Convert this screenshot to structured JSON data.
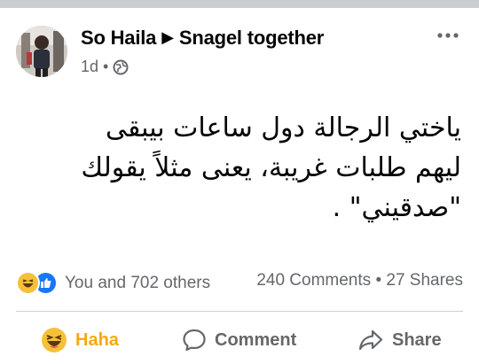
{
  "post": {
    "author": "So Haila",
    "group": "Snagel together",
    "time": "1d",
    "separator": "•",
    "text_lines": [
      "ياختي الرجالة دول ساعات بيبقى",
      "ليهم طلبات غريبة، يعنى مثلاً يقولك",
      "\"صدقيني\" ."
    ]
  },
  "stats": {
    "reactions_text": "You and 702 others",
    "comments_text": "240 Comments",
    "dot": "•",
    "shares_text": "27 Shares"
  },
  "actions": {
    "haha_label": "Haha",
    "comment_label": "Comment",
    "share_label": "Share"
  },
  "colors": {
    "accent_haha": "#f7a80d",
    "like_blue": "#1877f2",
    "secondary_text": "#65676b"
  },
  "icons": {
    "author_arrow": "right-triangle-icon",
    "privacy": "globe-icon",
    "more": "more-options-icon",
    "haha": "haha-emoji-icon",
    "like": "like-thumb-icon",
    "comment": "comment-bubble-icon",
    "share": "share-arrow-icon"
  }
}
